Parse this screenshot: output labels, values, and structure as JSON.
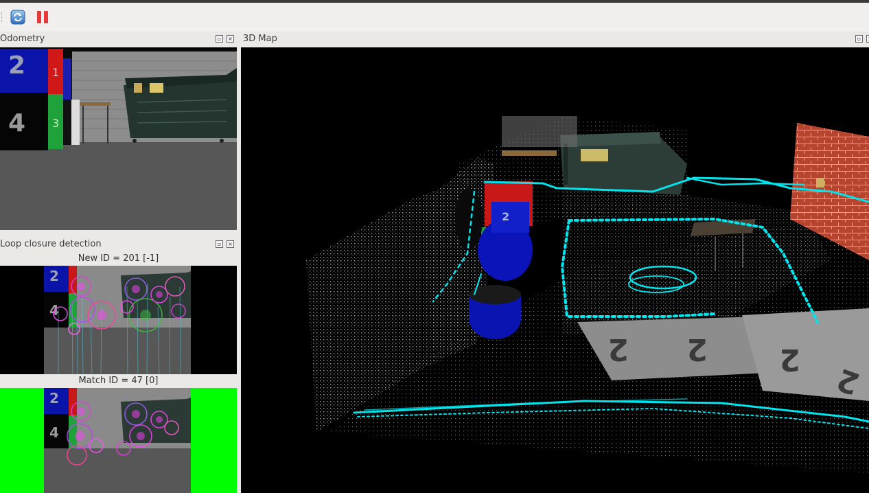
{
  "toolbar": {
    "refresh_icon": "refresh-icon",
    "pause_icon": "pause-icon"
  },
  "docks": {
    "odometry": {
      "title": "Odometry"
    },
    "loop": {
      "title": "Loop closure detection",
      "new_caption": "New ID = 201 [-1]",
      "match_caption": "Match ID = 47 [0]"
    },
    "map": {
      "title": "3D Map"
    }
  },
  "scene_labels": {
    "box_2": "2",
    "box_4": "4",
    "box_1": "1",
    "box_3": "3",
    "cyl_2": "2"
  },
  "colors": {
    "panel_bg": "#000000",
    "match_green": "#00ff00",
    "trajectory_cyan": "#00e5ee"
  }
}
